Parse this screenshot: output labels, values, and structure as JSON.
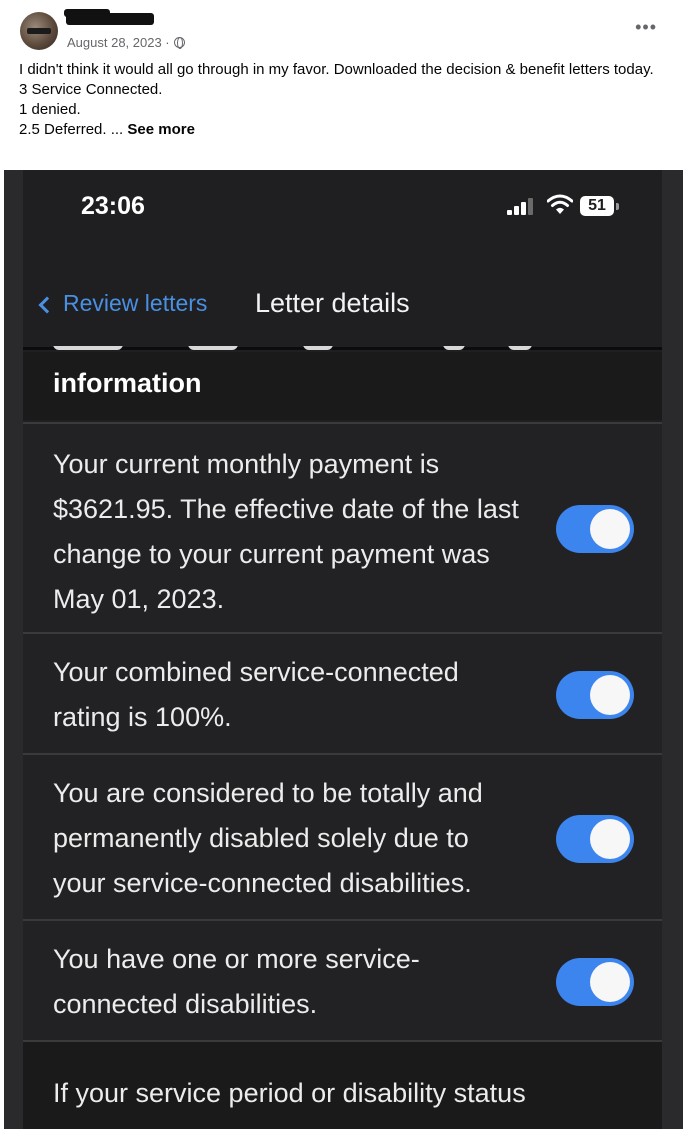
{
  "post": {
    "date": "August 28, 2023 ·",
    "lines": [
      "I didn't think it would all go through in my favor. Downloaded the decision & benefit letters today.",
      "3 Service Connected.",
      "1 denied."
    ],
    "last_line": "2.5 Deferred. ...",
    "see_more": "See more"
  },
  "phone": {
    "time": "23:06",
    "battery": "51",
    "nav": {
      "back_label": "Review letters",
      "title": "Letter details"
    },
    "section_title": "information",
    "rows": [
      {
        "text": "Your current monthly payment is $3621.95. The effective date of the last change to your current payment was May 01, 2023.",
        "toggled": true
      },
      {
        "text": "Your combined service-connected rating is 100%.",
        "toggled": true
      },
      {
        "text": "You are considered to be totally and permanently disabled solely due to your service-connected disabilities.",
        "toggled": true
      },
      {
        "text": "You have one or more service-connected disabilities.",
        "toggled": true
      }
    ],
    "footer_text": "If your service period or disability status"
  },
  "colors": {
    "accent": "#4a90e2",
    "toggle_on": "#3c84ee",
    "background": "#1f1f21"
  }
}
